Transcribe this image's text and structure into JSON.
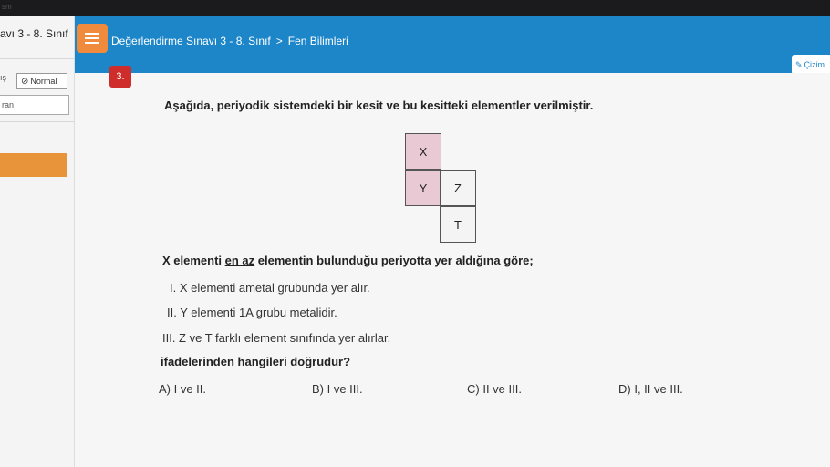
{
  "bezel": {
    "text": "sm"
  },
  "left_panel": {
    "title": "avı 3 - 8. Sınıf",
    "mode_prev": "ış",
    "mode_icon": "⊘",
    "mode_label": "Normal",
    "search_text": "ran"
  },
  "header": {
    "breadcrumb": [
      "Değerlendirme Sınavı 3 - 8. Sınıf",
      "Fen Bilimleri"
    ],
    "crumb_sep": ">",
    "draw_icon": "✎",
    "draw_label": "Çizim"
  },
  "question": {
    "number": "3.",
    "stem": "Aşağıda, periyodik sistemdeki bir kesit ve bu kesitteki elementler verilmiştir.",
    "grid": {
      "cells": [
        {
          "label": "X",
          "fill": "#e9c9d3"
        },
        {
          "label": "Y",
          "fill": "#e9c9d3"
        },
        {
          "label": "Z",
          "fill": "#f4f4f4"
        },
        {
          "label": "T",
          "fill": "#f4f4f4"
        }
      ]
    },
    "condition": {
      "part1": "X elementi ",
      "underlined": "en az",
      "part2": " elementin bulunduğu periyotta yer aldığına göre;"
    },
    "statements": [
      "I.  X elementi ametal grubunda yer alır.",
      "II.  Y elementi 1A grubu metalidir.",
      "III.  Z ve T farklı element sınıfında yer alırlar."
    ],
    "ask": "ifadelerinden hangileri doğrudur?",
    "choices": [
      "A) I ve II.",
      "B) I ve III.",
      "C) II ve III.",
      "D) I, II ve III."
    ]
  }
}
